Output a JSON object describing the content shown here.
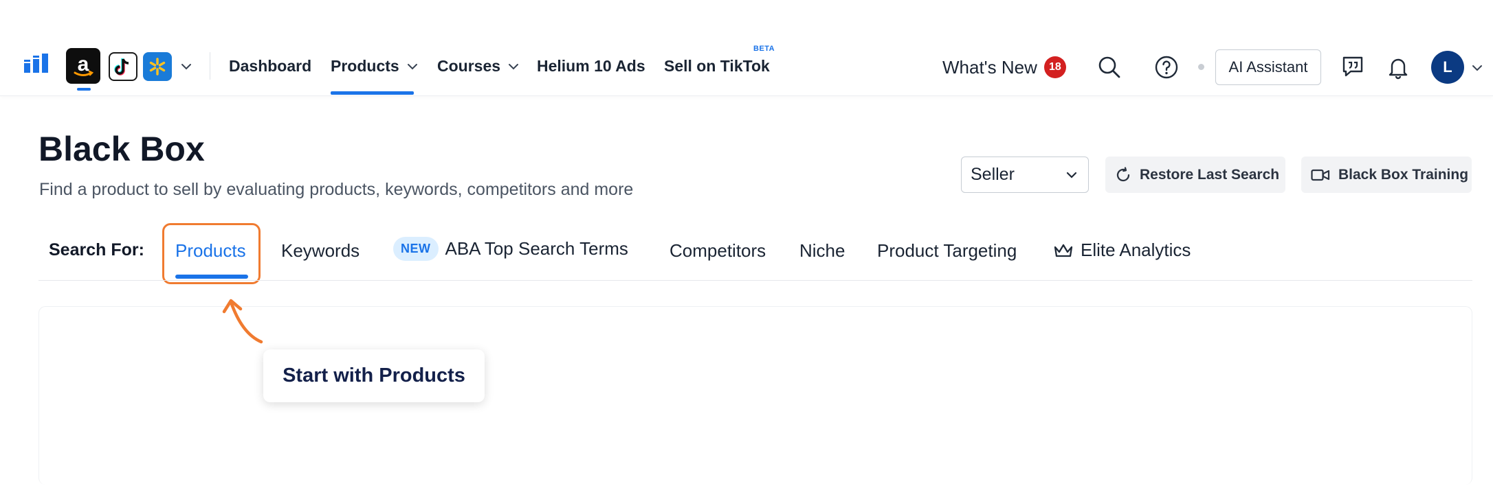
{
  "topbar": {
    "marketplaces": [
      "amazon-icon",
      "tiktok-icon",
      "walmart-icon"
    ],
    "nav": [
      {
        "label": "Dashboard"
      },
      {
        "label": "Products"
      },
      {
        "label": "Courses"
      },
      {
        "label": "Helium 10 Ads"
      },
      {
        "label": "Sell on TikTok"
      }
    ],
    "beta_label": "BETA",
    "whats_new": "What's New",
    "whats_new_count": "18",
    "ai_assistant": "AI Assistant",
    "avatar_initial": "L"
  },
  "header": {
    "title": "Black Box",
    "subtitle": "Find a product to sell by evaluating products, keywords, competitors and more",
    "seller_select": "Seller",
    "restore_label": "Restore Last Search",
    "training_label": "Black Box Training"
  },
  "search_for": {
    "label": "Search For:",
    "tabs": [
      {
        "label": "Products"
      },
      {
        "label": "Keywords"
      },
      {
        "label": "ABA Top Search Terms",
        "badge": "NEW"
      },
      {
        "label": "Competitors"
      },
      {
        "label": "Niche"
      },
      {
        "label": "Product Targeting"
      },
      {
        "label": "Elite Analytics"
      }
    ]
  },
  "callout": {
    "text": "Start with Products"
  },
  "colors": {
    "accent": "#1a73e8",
    "highlight": "#f07b30",
    "badge": "#d32020",
    "avatar": "#0b3a82"
  }
}
